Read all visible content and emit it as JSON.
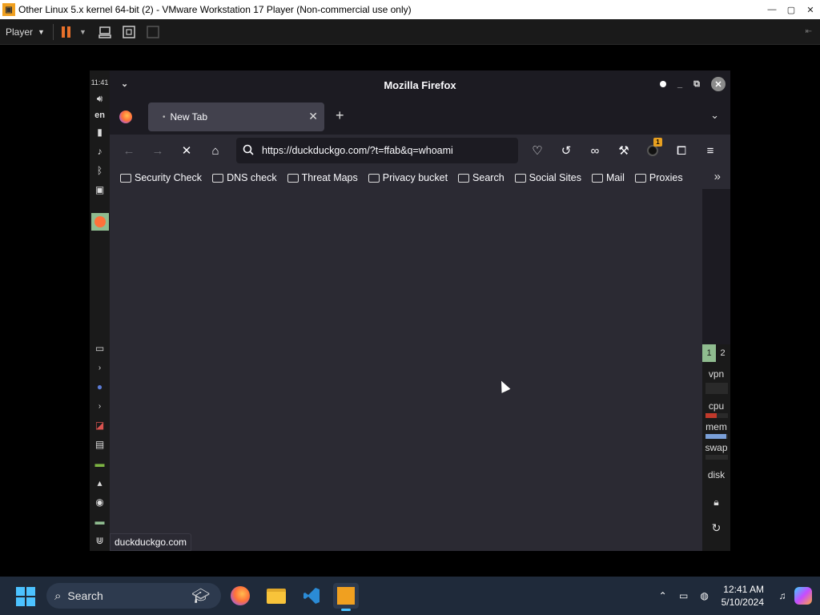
{
  "vm": {
    "title": "Other Linux 5.x kernel 64-bit (2) - VMware Workstation 17 Player (Non-commercial use only)",
    "player_label": "Player"
  },
  "guest": {
    "clock": "11:41",
    "lang": "en"
  },
  "firefox": {
    "window_title": "Mozilla Firefox",
    "tab_label": "New Tab",
    "url": "https://duckduckgo.com/?t=ffab&q=whoami",
    "extension_badge": "1",
    "bookmarks": [
      "Security Check",
      "DNS check",
      "Threat Maps",
      "Privacy bucket",
      "Search",
      "Social Sites",
      "Mail",
      "Proxies"
    ],
    "status_text": "duckduckgo.com"
  },
  "right_panel": {
    "workspaces": [
      "1",
      "2"
    ],
    "labels": {
      "vpn": "vpn",
      "cpu": "cpu",
      "mem": "mem",
      "swap": "swap",
      "disk": "disk"
    },
    "cpu_color": "#c0392b",
    "mem_color": "#7a9fd8"
  },
  "taskbar": {
    "search_placeholder": "Search",
    "time": "12:41 AM",
    "date": "5/10/2024"
  }
}
